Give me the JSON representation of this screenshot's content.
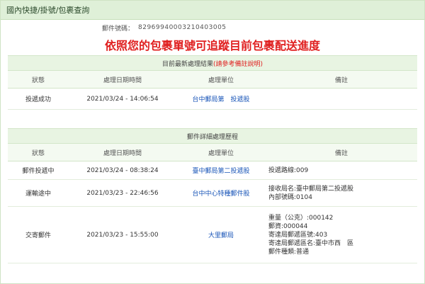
{
  "title": "國內快捷/掛號/包裹查詢",
  "mail_no": {
    "label": "郵件號碼：",
    "value": "82969940003210403005"
  },
  "headline": "依照您的包裹單號可追蹤目前包裹配送進度",
  "latest": {
    "title": "目前最新處理結果",
    "note": "(請參考備註說明)",
    "headers": [
      "狀態",
      "處理日期時間",
      "處理單位",
      "備註"
    ],
    "rows": [
      {
        "status": "投遞成功",
        "time": "2021/03/24 - 14:06:54",
        "unit": "台中郵局第　投遞股",
        "note": ""
      }
    ]
  },
  "history": {
    "title": "郵件詳細處理歷程",
    "headers": [
      "狀態",
      "處理日期時間",
      "處理單位",
      "備註"
    ],
    "rows": [
      {
        "status": "郵件投遞中",
        "time": "2021/03/24 - 08:38:24",
        "unit": "臺中郵局第二投遞股",
        "note": [
          "投遞路線:009"
        ]
      },
      {
        "status": "運輸途中",
        "time": "2021/03/23 - 22:46:56",
        "unit": "台中中心特種郵件股",
        "note": [
          "接收局名:臺中郵局第二投遞股",
          "內部號碼:0104"
        ]
      },
      {
        "status": "交寄郵件",
        "time": "2021/03/23 - 15:55:00",
        "unit": "大里郵局",
        "note": [
          "重量（公克）:000142",
          "郵資:000044",
          "寄達局郵遞區號:403",
          "寄達局郵遞區名:臺中市西　區",
          "郵件種類:普通"
        ]
      }
    ]
  }
}
